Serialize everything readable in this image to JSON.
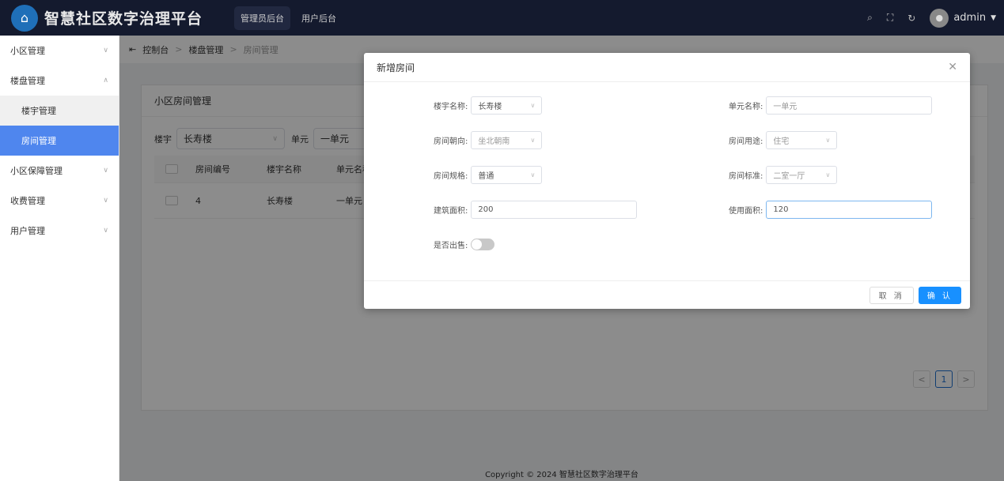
{
  "header": {
    "title": "智慧社区数字治理平台",
    "nav": [
      "管理员后台",
      "用户后台"
    ],
    "user": "admin"
  },
  "sidebar": {
    "items": [
      {
        "label": "小区管理"
      },
      {
        "label": "楼盘管理"
      },
      {
        "label": "楼宇管理"
      },
      {
        "label": "房间管理"
      },
      {
        "label": "小区保障管理"
      },
      {
        "label": "收费管理"
      },
      {
        "label": "用户管理"
      }
    ]
  },
  "breadcrumb": [
    "控制台",
    "楼盘管理",
    "房间管理"
  ],
  "card": {
    "title": "小区房间管理",
    "filter_building_label": "楼宇",
    "filter_building": "长寿楼",
    "filter_unit_label": "单元",
    "filter_unit": "一单元",
    "columns": [
      "房间编号",
      "楼宇名称",
      "单元名称"
    ],
    "rows": [
      [
        "4",
        "长寿楼",
        "一单元"
      ]
    ],
    "page": "1"
  },
  "footer": "Copyright © 2024 智慧社区数字治理平台",
  "dialog": {
    "title": "新增房间",
    "building_label": "楼宇名称:",
    "building": "长寿楼",
    "unit_label": "单元名称:",
    "unit_placeholder": "一单元",
    "orientation_label": "房间朝向:",
    "orientation_placeholder": "坐北朝南",
    "usage_label": "房间用途:",
    "usage_placeholder": "住宅",
    "spec_label": "房间规格:",
    "spec": "普通",
    "standard_label": "房间标准:",
    "standard_placeholder": "二室一厅",
    "build_area_label": "建筑面积:",
    "build_area": "200",
    "use_area_label": "使用面积:",
    "use_area": "120",
    "sold_label": "是否出售:",
    "sold": false,
    "cancel": "取 消",
    "confirm": "确 认"
  },
  "colors": {
    "header": "#141a2e",
    "primary": "#1890ff",
    "sidebar_active": "#4f86ee"
  }
}
